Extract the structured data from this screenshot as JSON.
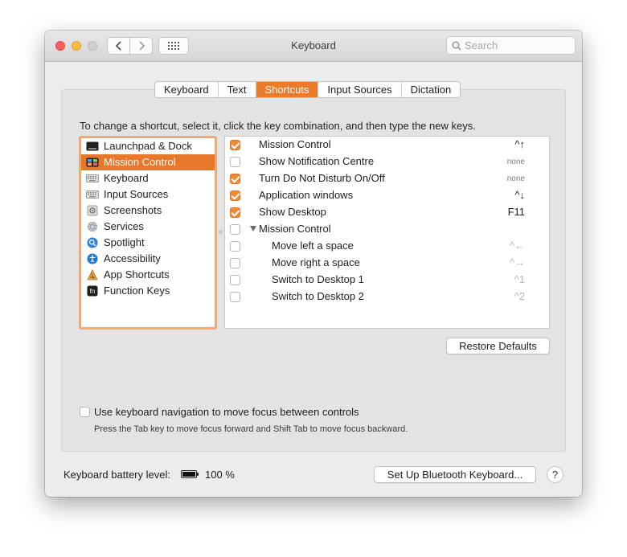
{
  "window": {
    "title": "Keyboard",
    "search_placeholder": "Search"
  },
  "tabs": [
    {
      "label": "Keyboard",
      "active": false
    },
    {
      "label": "Text",
      "active": false
    },
    {
      "label": "Shortcuts",
      "active": true
    },
    {
      "label": "Input Sources",
      "active": false
    },
    {
      "label": "Dictation",
      "active": false
    }
  ],
  "instruction": "To change a shortcut, select it, click the key combination, and then type the new keys.",
  "categories": [
    {
      "label": "Launchpad & Dock",
      "icon": "launchpad-dock-icon",
      "selected": false
    },
    {
      "label": "Mission Control",
      "icon": "mission-control-icon",
      "selected": true
    },
    {
      "label": "Keyboard",
      "icon": "keyboard-icon",
      "selected": false
    },
    {
      "label": "Input Sources",
      "icon": "input-sources-icon",
      "selected": false
    },
    {
      "label": "Screenshots",
      "icon": "screenshots-icon",
      "selected": false
    },
    {
      "label": "Services",
      "icon": "gear-icon",
      "selected": false
    },
    {
      "label": "Spotlight",
      "icon": "spotlight-icon",
      "selected": false
    },
    {
      "label": "Accessibility",
      "icon": "accessibility-icon",
      "selected": false
    },
    {
      "label": "App Shortcuts",
      "icon": "app-shortcuts-icon",
      "selected": false
    },
    {
      "label": "Function Keys",
      "icon": "fn-key-icon",
      "selected": false
    }
  ],
  "shortcuts": [
    {
      "label": "Mission Control",
      "key": "^↑",
      "checked": true,
      "indent": 0,
      "disclosure": false,
      "key_style": "normal"
    },
    {
      "label": "Show Notification Centre",
      "key": "none",
      "checked": false,
      "indent": 0,
      "disclosure": false,
      "key_style": "none"
    },
    {
      "label": "Turn Do Not Disturb On/Off",
      "key": "none",
      "checked": true,
      "indent": 0,
      "disclosure": false,
      "key_style": "none"
    },
    {
      "label": "Application windows",
      "key": "^↓",
      "checked": true,
      "indent": 0,
      "disclosure": false,
      "key_style": "normal"
    },
    {
      "label": "Show Desktop",
      "key": "F11",
      "checked": true,
      "indent": 0,
      "disclosure": false,
      "key_style": "normal"
    },
    {
      "label": "Mission Control",
      "key": "",
      "checked": false,
      "indent": 0,
      "disclosure": true,
      "key_style": "normal"
    },
    {
      "label": "Move left a space",
      "key": "^←",
      "checked": false,
      "indent": 1,
      "disclosure": false,
      "key_style": "dim"
    },
    {
      "label": "Move right a space",
      "key": "^→",
      "checked": false,
      "indent": 1,
      "disclosure": false,
      "key_style": "dim"
    },
    {
      "label": "Switch to Desktop 1",
      "key": "^1",
      "checked": false,
      "indent": 1,
      "disclosure": false,
      "key_style": "dim"
    },
    {
      "label": "Switch to Desktop 2",
      "key": "^2",
      "checked": false,
      "indent": 1,
      "disclosure": false,
      "key_style": "dim"
    }
  ],
  "restore_defaults": "Restore Defaults",
  "keyboard_navigation": {
    "label": "Use keyboard navigation to move focus between controls",
    "checked": false,
    "hint": "Press the Tab key to move focus forward and Shift Tab to move focus backward."
  },
  "battery": {
    "label": "Keyboard battery level:",
    "value": "100 %",
    "level_percent": 100
  },
  "bluetooth_button": "Set Up Bluetooth Keyboard...",
  "help_button": "?",
  "colors": {
    "accent": "#e9772a",
    "focus_ring": "#f2a876",
    "checkbox_on": "#ef8a35"
  }
}
